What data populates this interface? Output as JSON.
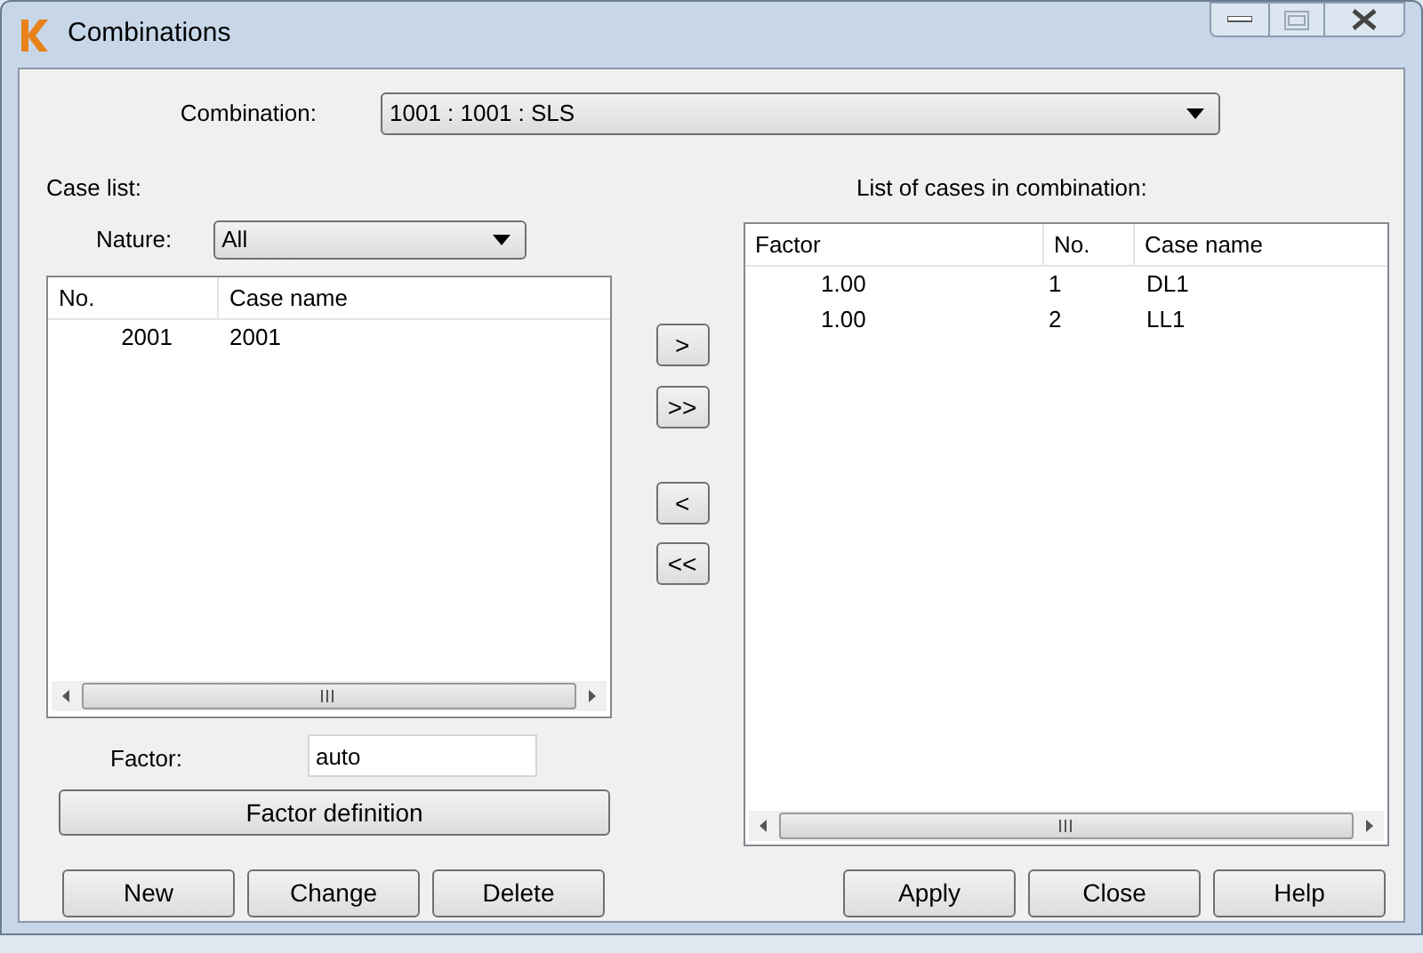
{
  "window": {
    "title": "Combinations"
  },
  "combination": {
    "label": "Combination:",
    "value": "1001 : 1001 : SLS"
  },
  "case_list": {
    "label": "Case list:",
    "nature": {
      "label": "Nature:",
      "value": "All"
    },
    "columns": [
      "No.",
      "Case name"
    ],
    "rows": [
      {
        "no": "2001",
        "name": "2001"
      }
    ]
  },
  "transfer_buttons": [
    ">",
    ">>",
    "<",
    "<<"
  ],
  "combination_list": {
    "label": "List of cases in combination:",
    "columns": [
      "Factor",
      "No.",
      "Case name"
    ],
    "rows": [
      {
        "factor": "1.00",
        "no": "1",
        "name": "DL1"
      },
      {
        "factor": "1.00",
        "no": "2",
        "name": "LL1"
      }
    ]
  },
  "factor": {
    "label": "Factor:",
    "value": "auto"
  },
  "factor_definition_button": "Factor definition",
  "buttons_left": [
    "New",
    "Change",
    "Delete"
  ],
  "buttons_right": [
    "Apply",
    "Close",
    "Help"
  ]
}
